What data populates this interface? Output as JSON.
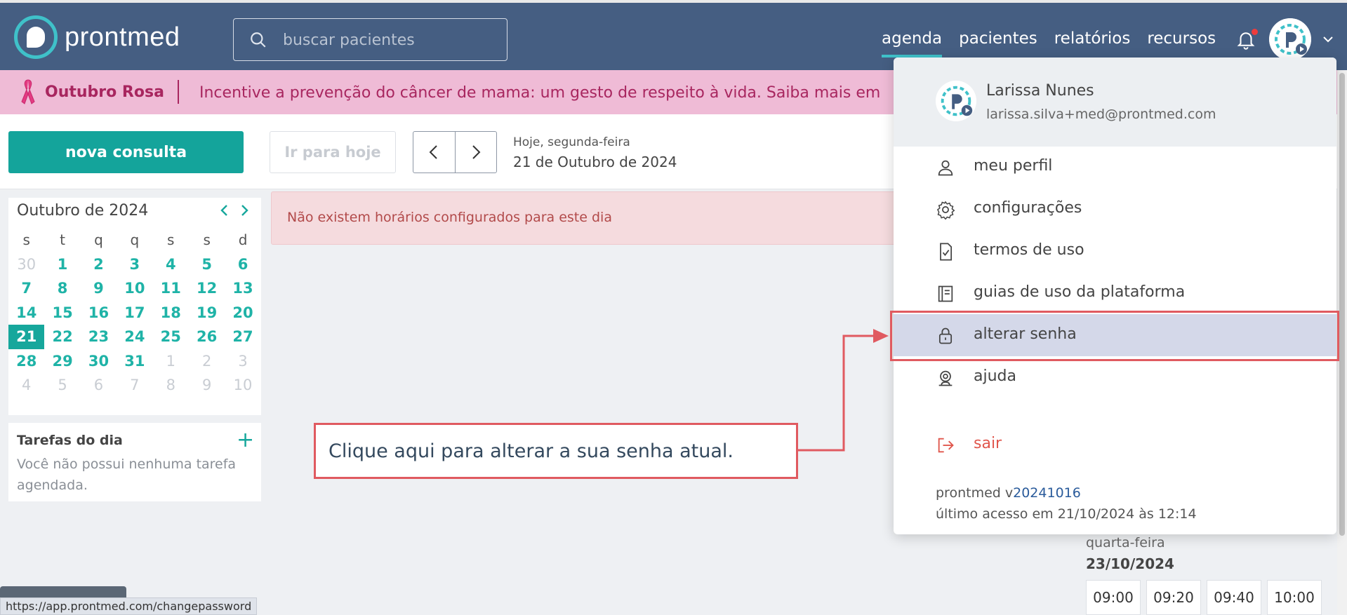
{
  "nav": {
    "logo_text": "prontmed",
    "search_placeholder": "buscar pacientes",
    "links": [
      "agenda",
      "pacientes",
      "relatórios",
      "recursos"
    ],
    "active_link": "agenda"
  },
  "banner": {
    "title": "Outubro Rosa",
    "text": "Incentive a prevenção do câncer de mama: um gesto de respeito à vida.  Saiba mais em"
  },
  "toolbar": {
    "new_button": "nova consulta",
    "today_button": "Ir para hoje",
    "date_small": "Hoje, segunda-feira",
    "date_big": "21 de Outubro de 2024"
  },
  "calendar": {
    "month": "Outubro de 2024",
    "weekdays": [
      "s",
      "t",
      "q",
      "q",
      "s",
      "s",
      "d"
    ],
    "weeks": [
      [
        "30",
        "1",
        "2",
        "3",
        "4",
        "5",
        "6"
      ],
      [
        "7",
        "8",
        "9",
        "10",
        "11",
        "12",
        "13"
      ],
      [
        "14",
        "15",
        "16",
        "17",
        "18",
        "19",
        "20"
      ],
      [
        "21",
        "22",
        "23",
        "24",
        "25",
        "26",
        "27"
      ],
      [
        "28",
        "29",
        "30",
        "31",
        "1",
        "2",
        "3"
      ],
      [
        "4",
        "5",
        "6",
        "7",
        "8",
        "9",
        "10"
      ]
    ],
    "today": "21"
  },
  "tasks": {
    "title": "Tarefas do dia",
    "empty": "Você não possui nenhuma tarefa agendada."
  },
  "alert": {
    "text": "Não existem horários configurados para este dia"
  },
  "week_card": {
    "day": "quarta-feira",
    "date": "23/10/2024",
    "slots": [
      "09:00",
      "09:20",
      "09:40",
      "10:00"
    ]
  },
  "status_url": "https://app.prontmed.com/changepassword",
  "dropdown": {
    "name": "Larissa Nunes",
    "email": "larissa.silva+med@prontmed.com",
    "items": [
      {
        "label": "meu perfil",
        "icon": "user-icon"
      },
      {
        "label": "configurações",
        "icon": "gear-icon"
      },
      {
        "label": "termos de uso",
        "icon": "document-check-icon"
      },
      {
        "label": "guias de uso da plataforma",
        "icon": "book-icon"
      },
      {
        "label": "alterar senha",
        "icon": "lock-icon"
      },
      {
        "label": "ajuda",
        "icon": "support-icon"
      }
    ],
    "exit_label": "sair",
    "version_prefix": "prontmed v",
    "version": "20241016",
    "last_access": "último acesso em 21/10/2024 às 12:14"
  },
  "annotation": {
    "callout": "Clique aqui para alterar a sua senha atual."
  },
  "colors": {
    "nav_bg": "#455e82",
    "accent": "#14a49b",
    "banner_bg": "#efbbd6",
    "highlight": "#e05a60"
  }
}
